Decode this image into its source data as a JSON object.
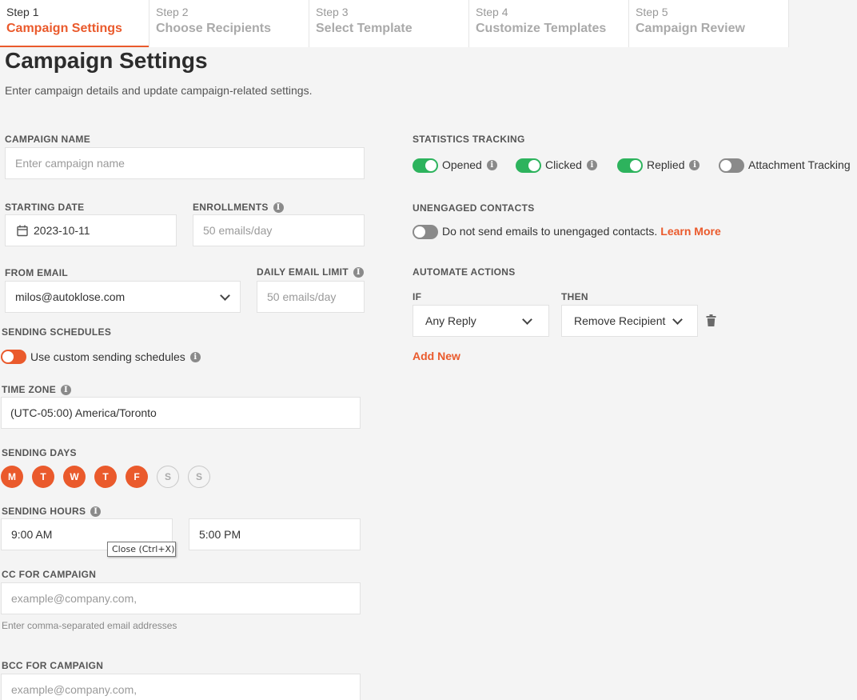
{
  "steps": [
    {
      "num": "Step 1",
      "name": "Campaign Settings"
    },
    {
      "num": "Step 2",
      "name": "Choose Recipients"
    },
    {
      "num": "Step 3",
      "name": "Select Template"
    },
    {
      "num": "Step 4",
      "name": "Customize Templates"
    },
    {
      "num": "Step 5",
      "name": "Campaign Review"
    }
  ],
  "page": {
    "title": "Campaign Settings",
    "subtitle": "Enter campaign details and update campaign-related settings."
  },
  "campaign_name": {
    "label": "CAMPAIGN NAME",
    "placeholder": "Enter campaign name"
  },
  "starting_date": {
    "label": "STARTING DATE",
    "value": "2023-10-11"
  },
  "enrollments": {
    "label": "ENROLLMENTS",
    "placeholder": "50 emails/day"
  },
  "from_email": {
    "label": "FROM EMAIL",
    "value": "milos@autoklose.com"
  },
  "daily_limit": {
    "label": "DAILY EMAIL LIMIT",
    "placeholder": "50 emails/day"
  },
  "sending_schedules": {
    "label": "SENDING SCHEDULES",
    "toggle_label": "Use custom sending schedules"
  },
  "time_zone": {
    "label": "TIME ZONE",
    "value": "(UTC-05:00) America/Toronto"
  },
  "sending_days": {
    "label": "SENDING DAYS",
    "days": [
      {
        "letter": "M",
        "active": true
      },
      {
        "letter": "T",
        "active": true
      },
      {
        "letter": "W",
        "active": true
      },
      {
        "letter": "T",
        "active": true
      },
      {
        "letter": "F",
        "active": true
      },
      {
        "letter": "S",
        "active": false
      },
      {
        "letter": "S",
        "active": false
      }
    ]
  },
  "sending_hours": {
    "label": "SENDING HOURS",
    "start": "9:00 AM",
    "end": "5:00 PM"
  },
  "tooltip": "Close (Ctrl+X)",
  "cc": {
    "label": "CC FOR CAMPAIGN",
    "placeholder": "example@company.com,",
    "hint": "Enter comma-separated email addresses"
  },
  "bcc": {
    "label": "BCC FOR CAMPAIGN",
    "placeholder": "example@company.com,"
  },
  "stats": {
    "label": "STATISTICS TRACKING",
    "opened": "Opened",
    "clicked": "Clicked",
    "replied": "Replied",
    "attachment": "Attachment Tracking"
  },
  "unengaged": {
    "label": "UNENGAGED CONTACTS",
    "text": "Do not send emails to unengaged contacts.",
    "link": "Learn More"
  },
  "automate": {
    "label": "AUTOMATE ACTIONS",
    "if_label": "IF",
    "then_label": "THEN",
    "if_value": "Any Reply",
    "then_value": "Remove Recipient",
    "add_new": "Add New"
  },
  "colors": {
    "accent": "#ea5a2c",
    "success": "#2db35d"
  }
}
